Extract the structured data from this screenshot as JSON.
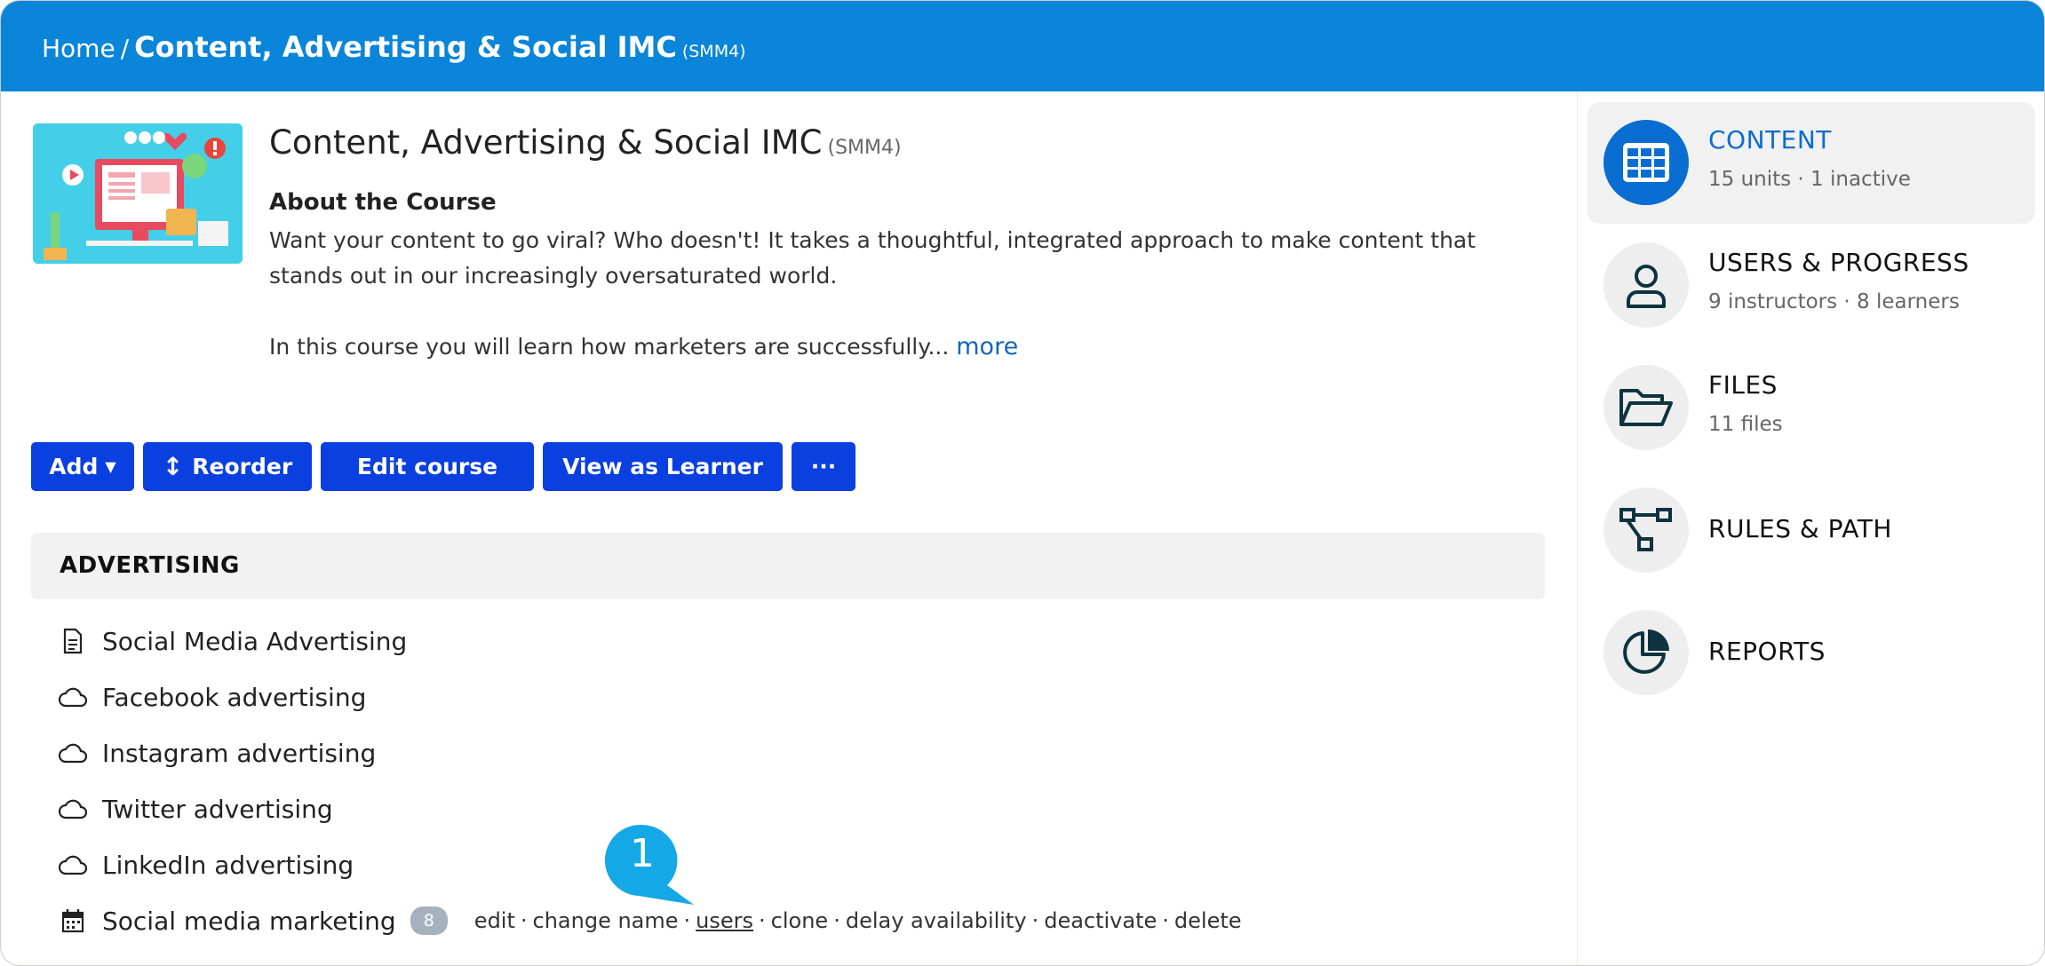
{
  "breadcrumb": {
    "home": "Home",
    "separator": "/",
    "current": "Content, Advertising & Social IMC",
    "code": "(SMM4)"
  },
  "course": {
    "title": "Content, Advertising & Social IMC",
    "code": "(SMM4)",
    "about_heading": "About the Course",
    "about_paragraph1": "Want your content to go viral? Who doesn't! It takes a thoughtful, integrated approach to make content that stands out in our increasingly oversaturated world.",
    "about_paragraph2": "In this course you will learn how marketers are successfully...",
    "more_label": "more"
  },
  "toolbar": {
    "add_label": "Add",
    "reorder_label": "Reorder",
    "edit_label": "Edit course",
    "view_label": "View as Learner",
    "more_label": "···"
  },
  "section": {
    "title": "ADVERTISING",
    "units": [
      {
        "label": "Social Media Advertising",
        "icon": "document-icon"
      },
      {
        "label": "Facebook advertising",
        "icon": "cloud-icon"
      },
      {
        "label": "Instagram advertising",
        "icon": "cloud-icon"
      },
      {
        "label": "Twitter advertising",
        "icon": "cloud-icon"
      },
      {
        "label": "LinkedIn advertising",
        "icon": "cloud-icon"
      },
      {
        "label": "Social media marketing",
        "icon": "calendar-icon",
        "badge": "8"
      }
    ],
    "actions": [
      "edit",
      "change name",
      "users",
      "clone",
      "delay availability",
      "deactivate",
      "delete"
    ],
    "action_separator": "·"
  },
  "callout": {
    "number": "1"
  },
  "sidebar": {
    "items": [
      {
        "label": "CONTENT",
        "sub": "15 units · 1 inactive",
        "icon": "grid-icon"
      },
      {
        "label": "USERS & PROGRESS",
        "sub": "9 instructors · 8 learners",
        "icon": "user-icon"
      },
      {
        "label": "FILES",
        "sub": "11 files",
        "icon": "folder-icon"
      },
      {
        "label": "RULES & PATH",
        "icon": "flow-icon"
      },
      {
        "label": "REPORTS",
        "icon": "pie-chart-icon"
      }
    ]
  },
  "colors": {
    "header": "#0a85d9",
    "button": "#0a3fe0",
    "active": "#0a6dd1",
    "callout": "#14a8e6",
    "link": "#1565c0"
  }
}
